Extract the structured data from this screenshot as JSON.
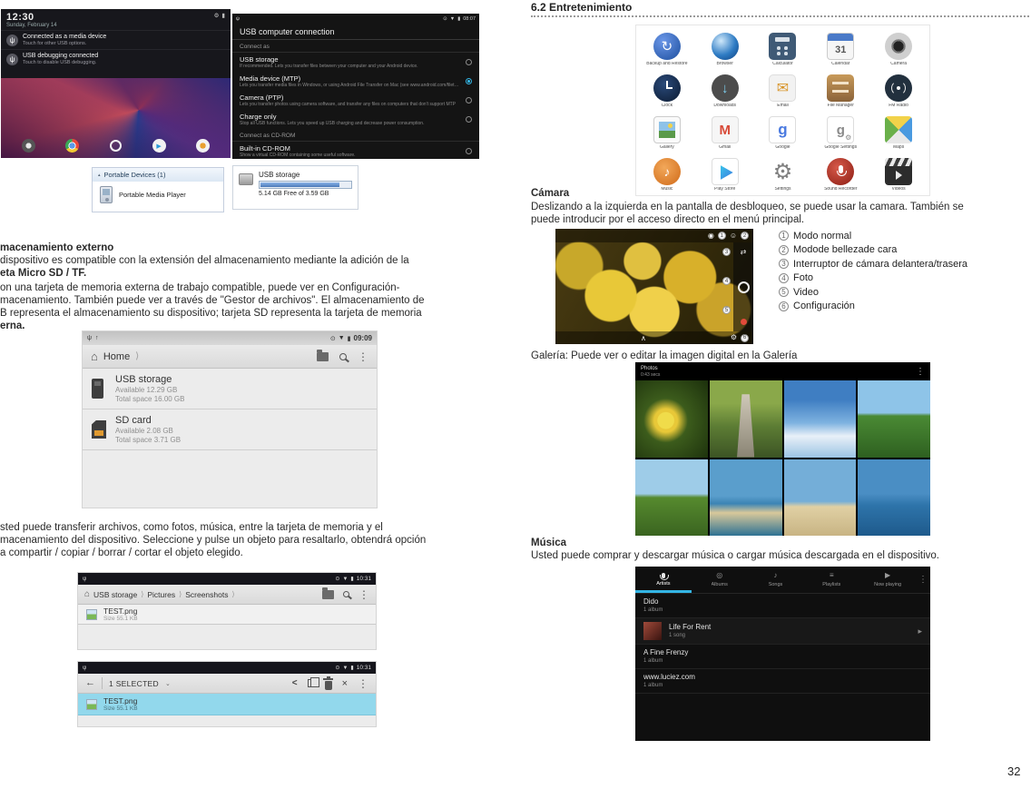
{
  "page": {
    "number": "32"
  },
  "colors": {
    "accent_blue": "#33b5e5",
    "selection_highlight": "#92d8ec",
    "dotted_divider": "#9a9a9a"
  },
  "icons": {
    "home": "⌂",
    "chevron": "⟩",
    "overflow": "⋮",
    "back": "←",
    "gear": "⚙",
    "expand_up": "∧",
    "usb": "ψ",
    "up": "↑",
    "signal": "▼",
    "battery": "▮",
    "status_dot": "⊙",
    "collapse": "▴",
    "share": "<",
    "cut": "×",
    "play": "▶",
    "note": "♪",
    "disc": "◎",
    "list": "≡",
    "arrow_right": "▸",
    "switch_camera": "⇄",
    "smile": "☺",
    "lens": "◉",
    "caret_down": "⌄"
  },
  "left": {
    "lockscreen": {
      "time": "12:30",
      "date": "Sunday, February 14",
      "notifications": [
        {
          "title": "Connected as a media device",
          "subtitle": "Touch for other USB options."
        },
        {
          "title": "USB debugging connected",
          "subtitle": "Touch to disable USB debugging."
        }
      ]
    },
    "usb_connection": {
      "status_time": "08:07",
      "title": "USB computer connection",
      "section1": "Connect as",
      "options": [
        {
          "title": "USB storage",
          "subtitle": "If recommended. Lets you transfer files between your computer and your Android device.",
          "selected": false
        },
        {
          "title": "Media device (MTP)",
          "subtitle": "Lets you transfer media files in Windows, or using Android File Transfer on Mac (see www.android.com/filetransfer)",
          "selected": true
        },
        {
          "title": "Camera (PTP)",
          "subtitle": "Lets you transfer photos using camera software, and transfer any files on computers that don't support MTP",
          "selected": false
        },
        {
          "title": "Charge only",
          "subtitle": "Stop all USB functions. Lets you speed up USB charging and decrease power consumption.",
          "selected": false
        }
      ],
      "section2": "Connect as CD-ROM",
      "options2": [
        {
          "title": "Built-in CD-ROM",
          "subtitle": "Show a virtual CD-ROM containing some useful software.",
          "selected": false
        }
      ]
    },
    "portable_devices": {
      "title": "Portable Devices (1)",
      "item": "Portable Media Player"
    },
    "usb_storage_window": {
      "title": "USB storage",
      "capacity": "5.14 GB Free of 3.59 GB"
    },
    "para1": [
      "macenamiento externo",
      "dispositivo es compatible con la extensión del almacenamiento mediante la adición de la",
      "eta Micro SD / TF."
    ],
    "para2": [
      "on una tarjeta de memoria externa de trabajo compatible, puede ver en Configuración-",
      "macenamiento. También puede ver a través de \"Gestor de archivos\". El almacenamiento de",
      "B representa el almacenamiento su dispositivo; tarjeta SD representa la tarjeta de memoria",
      "erna."
    ],
    "fm_home": {
      "status_time": "09:09",
      "location": "Home",
      "items": [
        {
          "title": "USB storage",
          "line1": "Available 12.29 GB",
          "line2": "Total space 16.00 GB"
        },
        {
          "title": "SD card",
          "line1": "Available 2.08 GB",
          "line2": "Total space 3.71 GB"
        }
      ]
    },
    "para3": [
      "sted puede transferir archivos, como fotos, música, entre la tarjeta de memoria y el",
      "macenamiento del dispositivo. Seleccione y pulse un objeto para resaltarlo, obtendrá opción",
      "a compartir / copiar / borrar / cortar el objeto elegido."
    ],
    "fm_pictures": {
      "status_time": "10:31",
      "crumbs": [
        "USB storage",
        "Pictures",
        "Screenshots"
      ],
      "file": {
        "title": "TEST.png",
        "subtitle": "Size 55.1 KB"
      }
    },
    "fm_selected": {
      "status_time": "10:31",
      "selected_label": "1 SELECTED",
      "file": {
        "title": "TEST.png",
        "subtitle": "Size 55.1 KB"
      }
    }
  },
  "right": {
    "section_title": "6.2 Entretenimiento",
    "apps": {
      "items": [
        {
          "label": "Backup and Restore",
          "icon": "backup-restore-icon",
          "glyph": "↻"
        },
        {
          "label": "Browser",
          "icon": "browser-icon",
          "glyph": ""
        },
        {
          "label": "Calculator",
          "icon": "calculator-icon",
          "glyph": ""
        },
        {
          "label": "Calendar",
          "icon": "calendar-icon",
          "glyph": "31"
        },
        {
          "label": "Camera",
          "icon": "camera-icon",
          "glyph": ""
        },
        {
          "label": "Clock",
          "icon": "clock-icon",
          "glyph": ""
        },
        {
          "label": "Downloads",
          "icon": "downloads-icon",
          "glyph": "↓"
        },
        {
          "label": "Email",
          "icon": "email-icon",
          "glyph": "✉"
        },
        {
          "label": "File Manager",
          "icon": "file-manager-icon",
          "glyph": ""
        },
        {
          "label": "FM Radio",
          "icon": "fm-radio-icon",
          "glyph": ""
        },
        {
          "label": "Gallery",
          "icon": "gallery-icon",
          "glyph": ""
        },
        {
          "label": "Gmail",
          "icon": "gmail-icon",
          "glyph": "M"
        },
        {
          "label": "Google",
          "icon": "google-icon",
          "glyph": "g"
        },
        {
          "label": "Google Settings",
          "icon": "google-settings-icon",
          "glyph": "g"
        },
        {
          "label": "Maps",
          "icon": "maps-icon",
          "glyph": ""
        },
        {
          "label": "Music",
          "icon": "music-icon",
          "glyph": "♪"
        },
        {
          "label": "Play Store",
          "icon": "play-store-icon",
          "glyph": ""
        },
        {
          "label": "Settings",
          "icon": "settings-icon",
          "glyph": "⚙"
        },
        {
          "label": "Sound Recorder",
          "icon": "sound-recorder-icon",
          "glyph": ""
        },
        {
          "label": "Videos",
          "icon": "videos-icon",
          "glyph": ""
        }
      ]
    },
    "camera": {
      "heading": "Cámara",
      "para": [
        "Deslizando a la izquierda en la pantalla de desbloqueo, se puede usar la camara. También se",
        "puede introducir por el acceso directo en el menú principal."
      ],
      "callouts": [
        {
          "num": "1",
          "text": "Modo normal"
        },
        {
          "num": "2",
          "text": "Modode bellezade cara"
        },
        {
          "num": "3",
          "text": "Interruptor de cámara delantera/trasera"
        },
        {
          "num": "4",
          "text": "Foto"
        },
        {
          "num": "5",
          "text": "Video"
        },
        {
          "num": "6",
          "text": "Configuración"
        }
      ]
    },
    "gallery": {
      "caption": "Galería: Puede ver o editar la imagen digital en la Galería",
      "screenshot": {
        "title": "Photos",
        "subtitle": "0:43 secs"
      }
    },
    "music": {
      "heading": "Música",
      "para": "Usted puede comprar y descargar música o cargar música descargada en el dispositivo.",
      "screenshot": {
        "tabs": [
          "Artists",
          "Albums",
          "Songs",
          "Playlists",
          "Now playing"
        ],
        "rows": [
          {
            "title": "Dido",
            "subtitle": "1 album"
          },
          {
            "title": "Life For Rent",
            "subtitle": "1 song"
          },
          {
            "title": "A Fine Frenzy",
            "subtitle": "1 album"
          },
          {
            "title": "www.luciez.com",
            "subtitle": "1 album"
          }
        ]
      }
    }
  }
}
